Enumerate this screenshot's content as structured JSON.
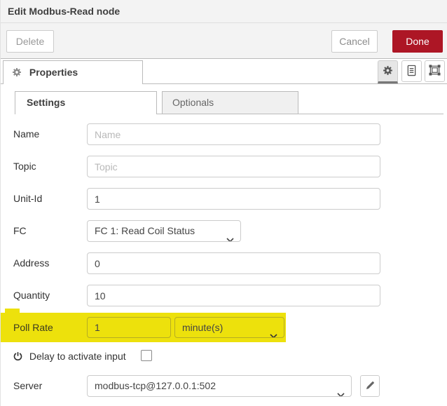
{
  "window": {
    "title": "Edit Modbus-Read node"
  },
  "toolbar": {
    "delete_label": "Delete",
    "cancel_label": "Cancel",
    "done_label": "Done"
  },
  "properties_tab": {
    "label": "Properties"
  },
  "tab_icons": {
    "gear": "gear-icon",
    "description": "description-icon",
    "appearance": "appearance-icon"
  },
  "subtabs": {
    "settings": "Settings",
    "optionals": "Optionals"
  },
  "fields": {
    "name": {
      "label": "Name",
      "placeholder": "Name",
      "value": ""
    },
    "topic": {
      "label": "Topic",
      "placeholder": "Topic",
      "value": ""
    },
    "unit_id": {
      "label": "Unit-Id",
      "value": "1"
    },
    "fc": {
      "label": "FC",
      "value": "FC 1: Read Coil Status"
    },
    "address": {
      "label": "Address",
      "value": "0"
    },
    "quantity": {
      "label": "Quantity",
      "value": "10"
    },
    "poll_rate": {
      "label": "Poll Rate",
      "value": "1",
      "unit": "minute(s)",
      "highlighted": true
    },
    "delay": {
      "label": "Delay to activate input",
      "checked": false
    },
    "server": {
      "label": "Server",
      "value": "modbus-tcp@127.0.0.1:502"
    }
  },
  "colors": {
    "done_red": "#AD1625",
    "highlight_yellow": "#EDE10C"
  }
}
